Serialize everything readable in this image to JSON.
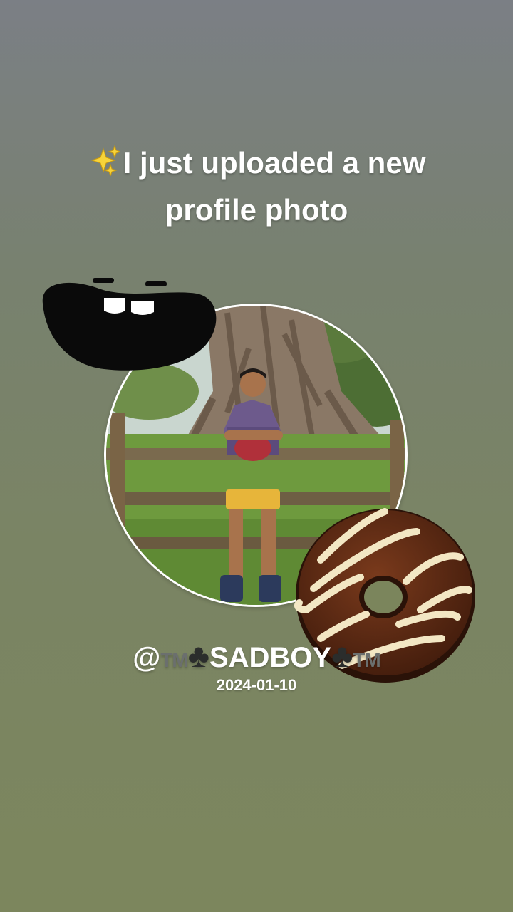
{
  "post": {
    "headline_icon": "sparkles-icon",
    "headline_text": "I just uploaded a new profile photo",
    "username_prefix": "@",
    "username_mark_left": "TM",
    "username_club_left": "♣",
    "username_main": "SADBOY",
    "username_club_right": "♣",
    "username_mark_right": "TM",
    "date": "2024-01-10"
  },
  "stickers": {
    "top_left": "cartoon-mouth-sticker",
    "bottom_right": "chocolate-donut-sticker"
  },
  "colors": {
    "background_top": "#7b7f85",
    "background_bottom": "#7c865d",
    "text": "#ffffff",
    "donut_chocolate": "#5a2a14",
    "donut_icing": "#f3e7c4"
  }
}
